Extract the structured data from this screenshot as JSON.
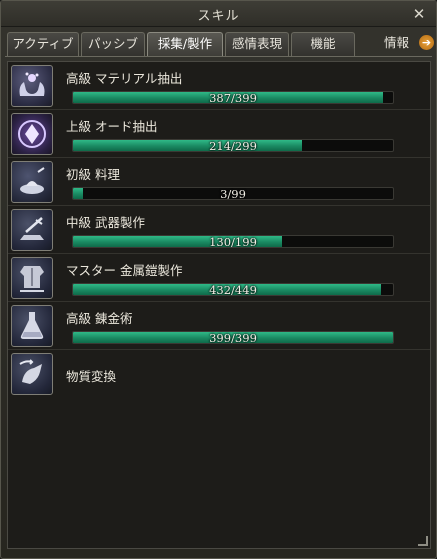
{
  "window": {
    "title": "スキル"
  },
  "tabs": [
    {
      "label": "アクティブ"
    },
    {
      "label": "パッシブ"
    },
    {
      "label": "採集/製作",
      "active": true
    },
    {
      "label": "感情表現"
    },
    {
      "label": "機能"
    }
  ],
  "info_tab": {
    "label": "情報",
    "icon": "arrow-right-icon"
  },
  "skills": [
    {
      "name": "高級  マテリアル抽出",
      "progress_text": "387/399",
      "current": 387,
      "max": 399,
      "icon": "extraction-hands-icon"
    },
    {
      "name": "上級  オード抽出",
      "progress_text": "214/299",
      "current": 214,
      "max": 299,
      "icon": "ode-crystal-icon"
    },
    {
      "name": "初級  料理",
      "progress_text": "3/99",
      "current": 3,
      "max": 99,
      "icon": "cooking-icon"
    },
    {
      "name": "中級  武器製作",
      "progress_text": "130/199",
      "current": 130,
      "max": 199,
      "icon": "weapon-anvil-icon"
    },
    {
      "name": "マスター  金属鎧製作",
      "progress_text": "432/449",
      "current": 432,
      "max": 449,
      "icon": "armor-icon"
    },
    {
      "name": "高級  錬金術",
      "progress_text": "399/399",
      "current": 399,
      "max": 399,
      "icon": "alchemy-flask-icon"
    },
    {
      "name": "物質変換",
      "icon": "transmute-hand-icon"
    }
  ],
  "colors": {
    "bar_fill": "#1f9a6c",
    "bar_bg": "#0c0c0b",
    "window_bg": "#2e2d28",
    "info_arrow": "#d98b24"
  }
}
